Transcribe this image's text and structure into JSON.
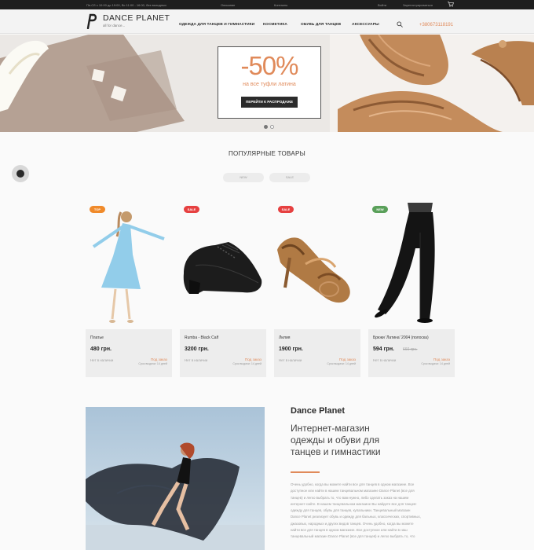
{
  "topbar": {
    "hours": "Пн-Сб с 10:00 до 19:00, Вс 11:00 - 16:00, без выходных",
    "links": [
      "Описание",
      "Контакты"
    ],
    "login": "Войти",
    "register": "Зарегистрироваться"
  },
  "header": {
    "brand": "DANCE PLANET",
    "tagline": "all for dance...",
    "nav": [
      "ОДЕЖДА ДЛЯ ТАНЦЕВ И ГИМНАСТИКИ",
      "КОСМЕТИКА",
      "ОБУВЬ ДЛЯ ТАНЦЕВ",
      "АКСЕССУАРЫ"
    ],
    "phone": "+380673118191"
  },
  "hero": {
    "discount": "-50%",
    "subtitle": "на все туфли латина",
    "button": "ПЕРЕЙТИ К РАСПРОДАЖЕ",
    "slides_total": 2,
    "active_slide": 1
  },
  "popular": {
    "title": "ПОПУЛЯРНЫЕ ТОВАРЫ",
    "filters": [
      "NEW",
      "SALE"
    ]
  },
  "products": [
    {
      "badge": "TOP",
      "badge_color": "#f08a2a",
      "name": "Платье",
      "price": "480 грн.",
      "old_price": "",
      "availability": "Нет в наличии",
      "order": "Под заказ",
      "shipping": "Срок выдачи: 14 дней"
    },
    {
      "badge": "SALE",
      "badge_color": "#e64040",
      "name": "Rumba - Black Calf",
      "price": "3200 грн.",
      "old_price": "",
      "availability": "Нет в наличии",
      "order": "Под заказ",
      "shipping": "Срок выдачи: 14 дней"
    },
    {
      "badge": "SALE",
      "badge_color": "#e64040",
      "name": "Лилия",
      "price": "1900 грн.",
      "old_price": "",
      "availability": "Нет в наличии",
      "order": "Под заказ",
      "shipping": "Срок выдачи: 14 дней"
    },
    {
      "badge": "NEW",
      "badge_color": "#5aa05a",
      "name": "Брюки 'Латина' 2004 (полоска)",
      "price": "594 грн.",
      "old_price": "660 грн.",
      "availability": "Нет в наличии",
      "order": "Под заказ",
      "shipping": "Срок выдачи: 14 дней"
    }
  ],
  "about": {
    "title": "Dance Planet",
    "heading": "Интернет-магазин одежды и обуви для танцев и гимнастики",
    "text": "Очень удобно, когда вы можете найти все для танцев в одном магазине. Все доступное или найти в нашем танцевальном магазине Dance Planet (все для танцев) и легко выбрать то, что вам нужно, либо сделать заказ на нашем интернет-сайте. В нашем танцевальном магазине Вы найдете все для танцев: одежду для танцев, обувь для танцев, купальники. Танцевальный магазин Dance Planet реализует обувь и одежду для бальных, классических, спортивных, джазовых, народных и других видов танцев. Очень удобно, когда вы можете найти все для танцев в одном магазине. Все доступное или найти в наш танцевальный магазин Dance Planet (все для танцев) и легко выбрать то, что"
  },
  "colors": {
    "accent": "#e08a5a",
    "dark": "#1e1e1e"
  }
}
